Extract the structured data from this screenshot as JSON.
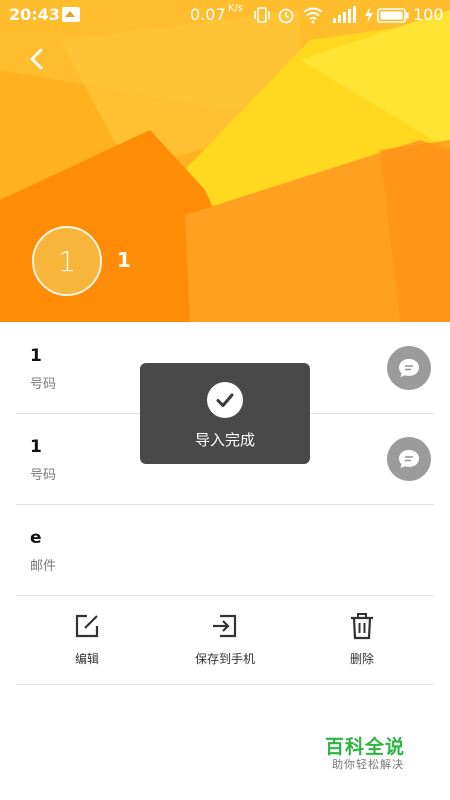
{
  "status_bar": {
    "time": "20:43",
    "network_speed": "0.07",
    "network_speed_unit": "K/s",
    "battery_percent": "100",
    "icons": [
      "image-notification-icon",
      "vibrate-icon",
      "alarm-icon",
      "wifi-icon",
      "signal-icon",
      "charging-icon",
      "battery-icon"
    ]
  },
  "header": {
    "avatar_initial": "1",
    "contact_name": "1",
    "colors": {
      "base": "#ffb21f",
      "dark_orange": "#ff8a00",
      "yellow": "#ffe22a"
    }
  },
  "details": [
    {
      "value": "1",
      "label": "号码",
      "action_icon": "message-icon"
    },
    {
      "value": "1",
      "label": "号码",
      "action_icon": "message-icon"
    },
    {
      "value": "e",
      "label": "邮件"
    }
  ],
  "actions": [
    {
      "label": "编辑",
      "icon": "edit-icon"
    },
    {
      "label": "保存到手机",
      "icon": "import-icon"
    },
    {
      "label": "删除",
      "icon": "trash-icon"
    }
  ],
  "toast": {
    "text": "导入完成",
    "icon": "check-icon"
  },
  "watermark": {
    "title": "百科全说",
    "subtitle": "助你轻松解决"
  }
}
